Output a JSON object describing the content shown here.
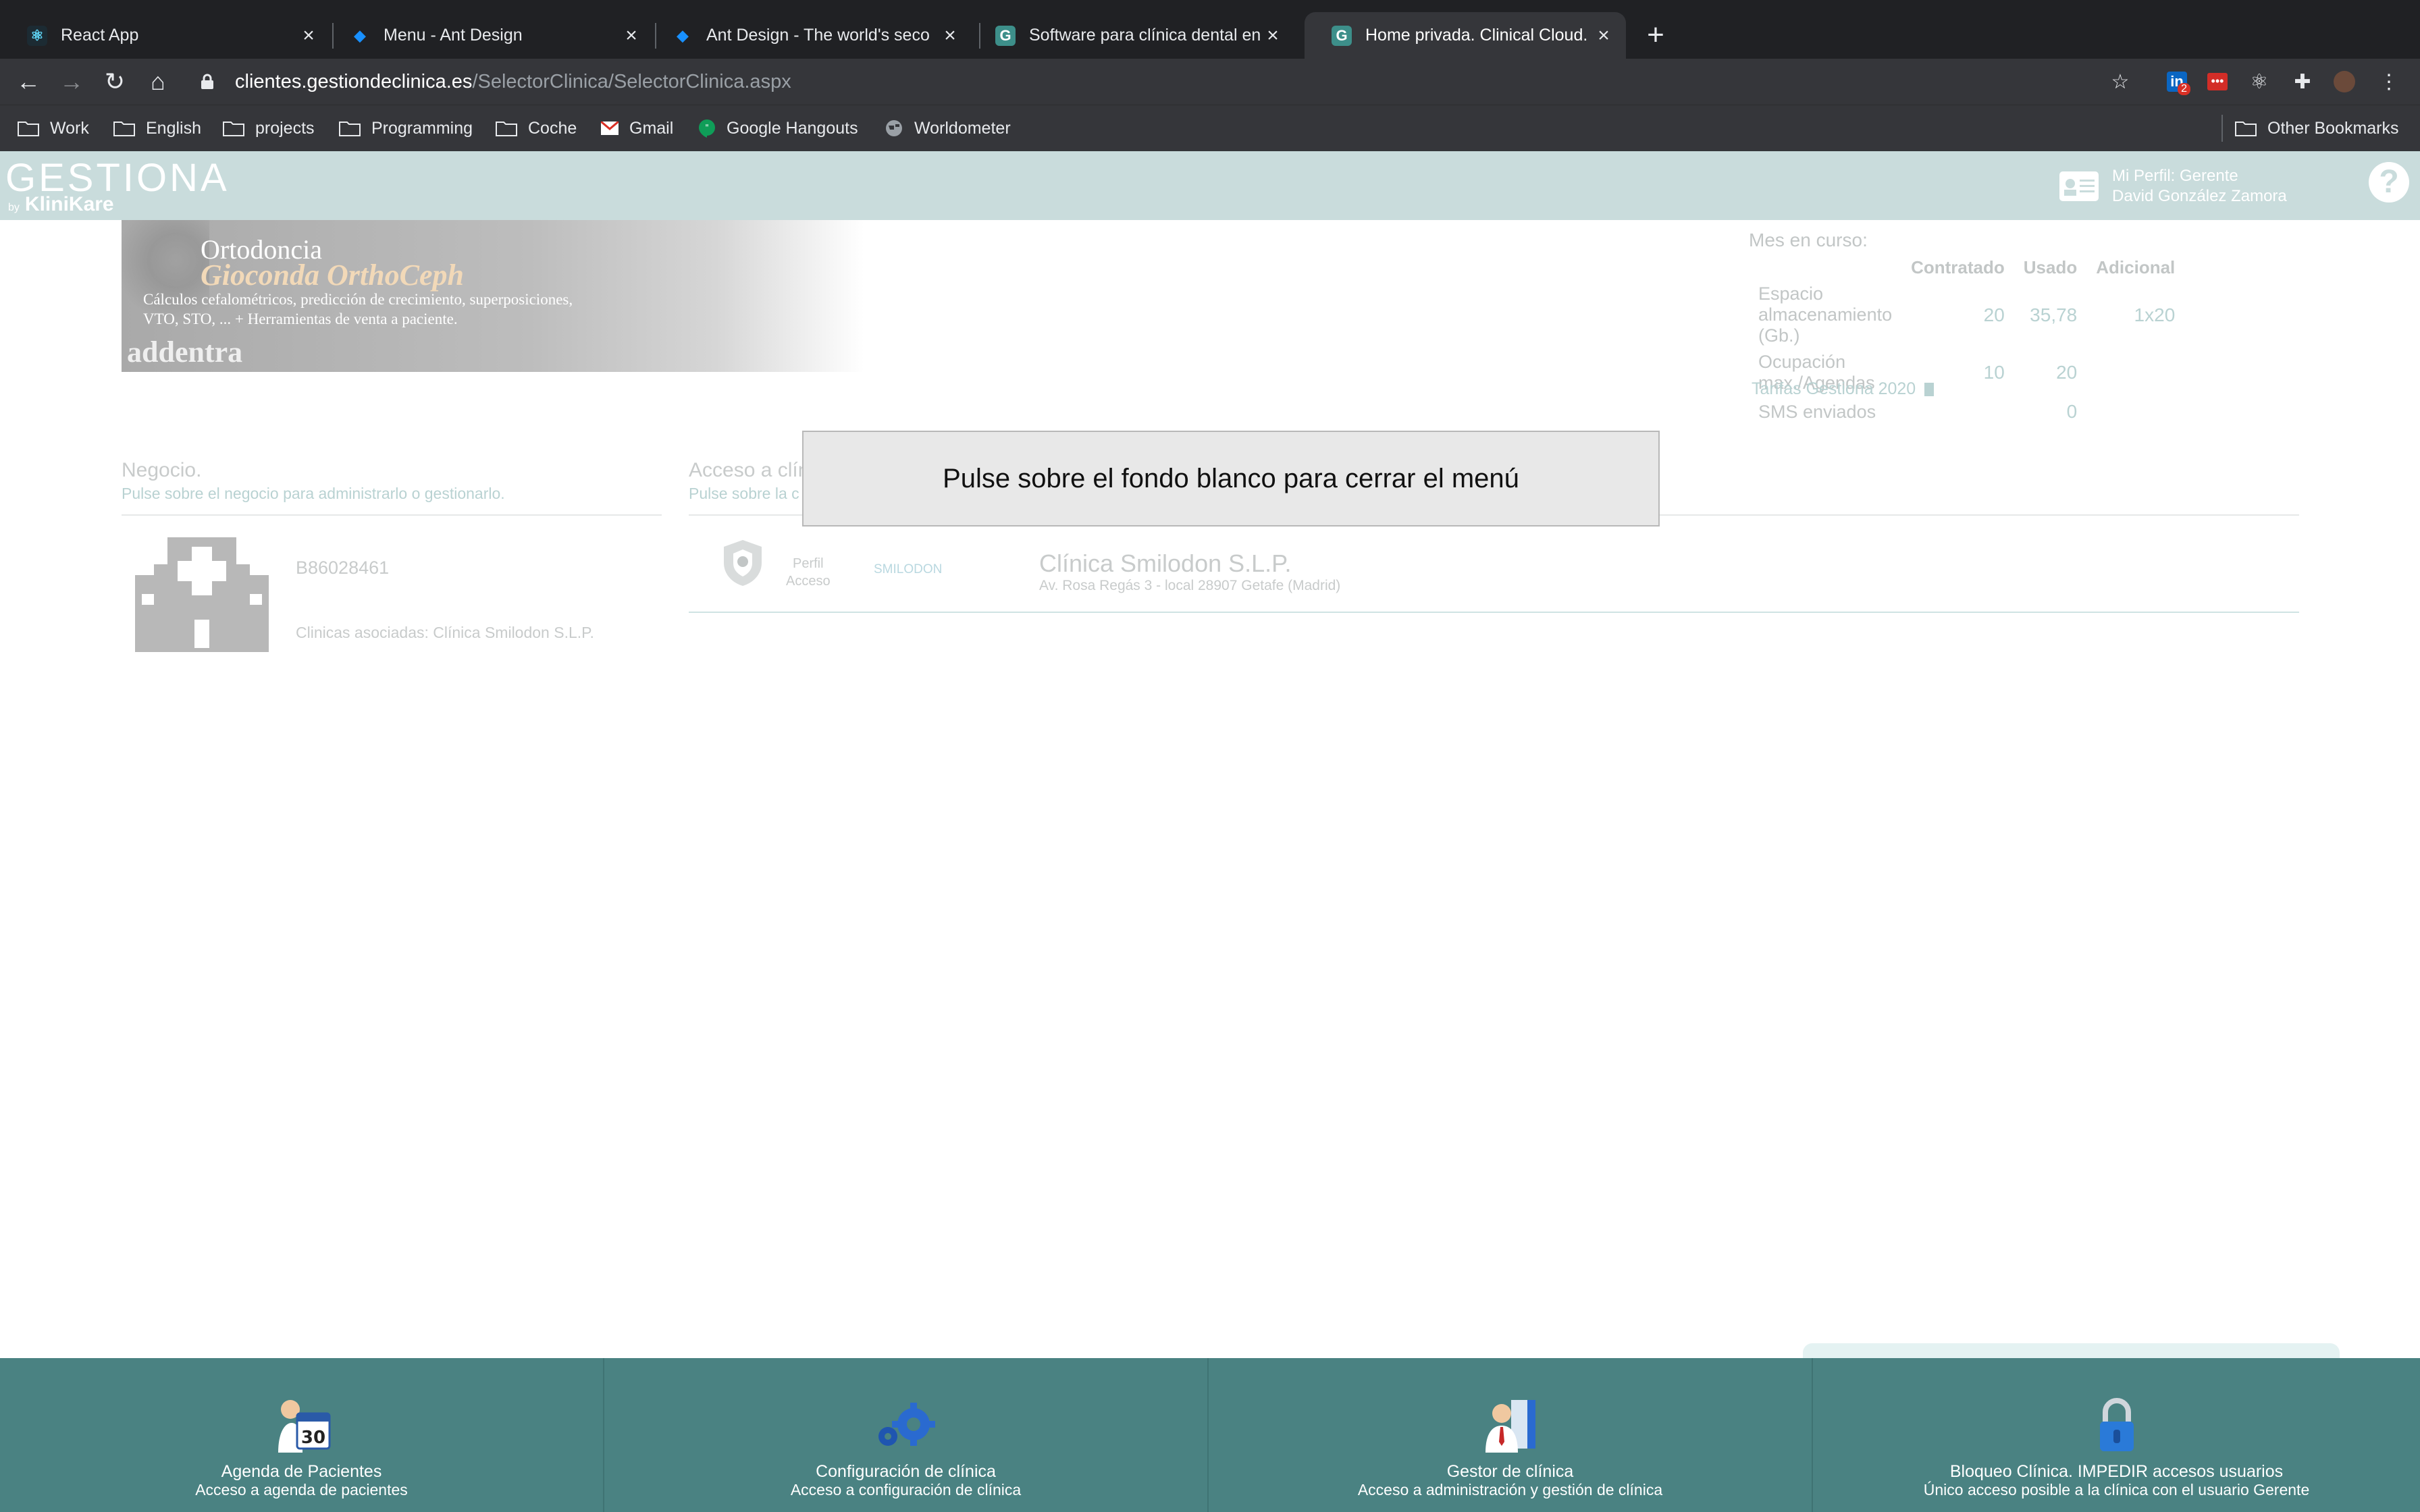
{
  "browser": {
    "tabs": [
      {
        "title": "React App",
        "favicon": "react-icon"
      },
      {
        "title": "Menu - Ant Design",
        "favicon": "ant-design-icon"
      },
      {
        "title": "Ant Design - The world's seco",
        "favicon": "ant-design-icon"
      },
      {
        "title": "Software para clínica dental en",
        "favicon": "gestiona-icon"
      },
      {
        "title": "Home privada. Clinical Cloud.",
        "favicon": "gestiona-icon",
        "active": true
      }
    ],
    "url_host": "clientes.gestiondeclinica.es",
    "url_path": "/SelectorClinica/SelectorClinica.aspx",
    "extension_badge": "2",
    "bookmarks": [
      "Work",
      "English",
      "projects",
      "Programming",
      "Coche",
      "Gmail",
      "Google Hangouts",
      "Worldometer"
    ],
    "other_bookmarks": "Other Bookmarks"
  },
  "app": {
    "logo": "GESTIONA",
    "logo_by": "by",
    "logo_brand": "KliniKare",
    "profile_line1": "Mi Perfil: Gerente",
    "profile_line2": "David González Zamora",
    "help": "?"
  },
  "banner": {
    "line1": "Ortodoncia",
    "line2": "Gioconda OrthoCeph",
    "line3": "Cálculos cefalométricos, predicción de crecimiento, superposiciones,",
    "line4": "VTO, STO, ... + Herramientas de venta a paciente.",
    "brand": "addentra"
  },
  "usage": {
    "heading": "Mes en curso:",
    "columns": [
      "Contratado",
      "Usado",
      "Adicional"
    ],
    "rows": [
      {
        "label": "Espacio almacenamiento (Gb.)",
        "contratado": "20",
        "usado": "35,78",
        "adicional": "1x20"
      },
      {
        "label": "Ocupación max./Agendas",
        "contratado": "10",
        "usado": "20",
        "adicional": ""
      },
      {
        "label": "SMS enviados",
        "contratado": "",
        "usado": "0",
        "adicional": ""
      }
    ],
    "tarifas_link": "Tarifas Gestiona 2020"
  },
  "negocio": {
    "title": "Negocio.",
    "subtitle": "Pulse sobre el negocio para administrarlo o gestionarlo.",
    "id": "B86028461",
    "assoc": "Clinicas asociadas: Clínica Smilodon S.L.P."
  },
  "acceso": {
    "title": "Acceso a clín",
    "subtitle": "Pulse sobre la c",
    "perfil_line1": "Perfil",
    "perfil_line2": "Acceso",
    "logo_text": "SMILODON",
    "clinic_name": "Clínica Smilodon S.L.P.",
    "clinic_address": "Av. Rosa Regás 3 - local 28907 Getafe (Madrid)"
  },
  "modal": {
    "message": "Pulse sobre el fondo blanco para cerrar el menú"
  },
  "bottom_menu": [
    {
      "title": "Agenda de Pacientes",
      "subtitle": "Acceso a agenda de pacientes",
      "icon": "calendar-icon"
    },
    {
      "title": "Configuración de clínica",
      "subtitle": "Acceso a configuración de clínica",
      "icon": "gears-icon"
    },
    {
      "title": "Gestor de clínica",
      "subtitle": "Acceso a administración y gestión de clínica",
      "icon": "manager-icon"
    },
    {
      "title": "Bloqueo Clínica. IMPEDIR accesos usuarios",
      "subtitle": "Único acceso posible a la clínica con el usuario Gerente",
      "icon": "lock-icon"
    }
  ],
  "colors": {
    "app_header": "#c9dcdc",
    "bottom_bar": "#4a8282",
    "accent_text": "#b9d2d2"
  }
}
